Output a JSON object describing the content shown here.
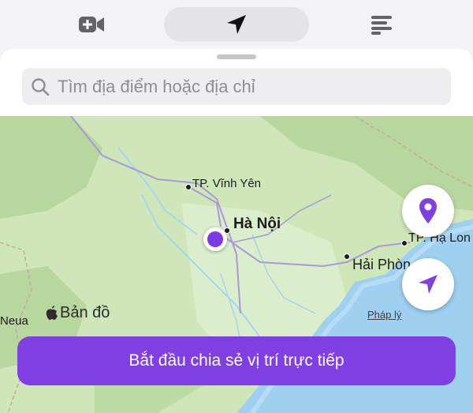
{
  "tabs": [
    {
      "name": "video-plus",
      "icon": "video-plus-icon"
    },
    {
      "name": "location",
      "icon": "location-arrow-icon",
      "selected": true
    },
    {
      "name": "list",
      "icon": "list-icon"
    }
  ],
  "search": {
    "placeholder": "Tìm địa điểm hoặc địa chỉ"
  },
  "map": {
    "labels": {
      "vinh_yen": "TP. Vĩnh Yên",
      "ha_noi": "Hà Nội",
      "hai_phong": "Hải Phòn",
      "ha_long": "TP. Hạ Lon",
      "neua": "Neua"
    },
    "brand": "Bản đồ",
    "legal": "Pháp lý"
  },
  "share_button": "Bắt đầu chia sẻ vị trí trực tiếp",
  "colors": {
    "accent": "#7f3fe3",
    "land": "#cfe6b8",
    "sea": "#9fd0f0",
    "user_dot": "#7a3ae6"
  }
}
